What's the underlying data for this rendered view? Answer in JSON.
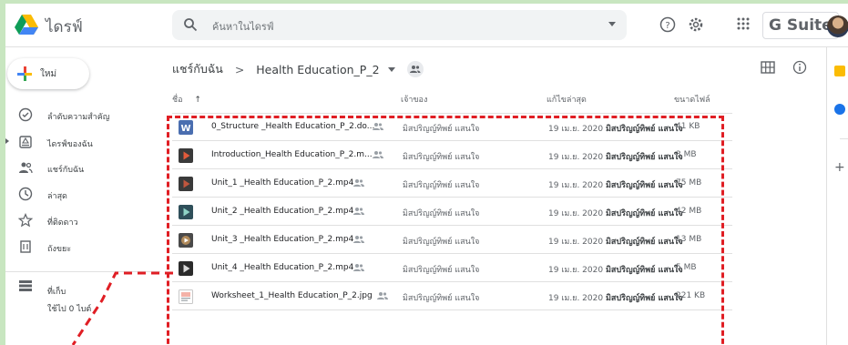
{
  "header": {
    "app_title": "ไดรฟ์",
    "search_placeholder": "ค้นหาในไดรฟ์",
    "brand": "G Suite"
  },
  "sidebar": {
    "new_label": "ใหม่",
    "items": [
      {
        "label": "ลำดับความสำคัญ",
        "icon": "check-circle-icon"
      },
      {
        "label": "ไดรฟ์ของฉัน",
        "icon": "my-drive-icon"
      },
      {
        "label": "แชร์กับฉัน",
        "icon": "shared-with-me-icon"
      },
      {
        "label": "ล่าสุด",
        "icon": "clock-icon"
      },
      {
        "label": "ที่ติดดาว",
        "icon": "star-icon"
      },
      {
        "label": "ถังขยะ",
        "icon": "trash-icon"
      }
    ],
    "storage": {
      "label": "ที่เก็บ",
      "used": "ใช้ไป 0 ไบต์"
    }
  },
  "breadcrumb": {
    "root": "แชร์กับฉัน",
    "current": "Health Education_P_2"
  },
  "columns": {
    "name": "ชื่อ",
    "sort_arrow": "↑",
    "owner": "เจ้าของ",
    "modified": "แก้ไขล่าสุด",
    "size": "ขนาดไฟล์"
  },
  "files": [
    {
      "name": "0_Structure _Health Education_P_2.do...",
      "type": "word",
      "owner": "มิสปริญญ์ทิพย์ แสนใจ",
      "date": "19 เม.ย. 2020",
      "modifier": "มิสปริญญ์ทิพย์ แสนใจ",
      "size": "41 KB"
    },
    {
      "name": "Introduction_Health Education_P_2.m...",
      "type": "video",
      "owner": "มิสปริญญ์ทิพย์ แสนใจ",
      "date": "19 เม.ย. 2020",
      "modifier": "มิสปริญญ์ทิพย์ แสนใจ",
      "size": "3 MB"
    },
    {
      "name": "Unit_1 _Health Education_P_2.mp4",
      "type": "video",
      "owner": "มิสปริญญ์ทิพย์ แสนใจ",
      "date": "19 เม.ย. 2020",
      "modifier": "มิสปริญญ์ทิพย์ แสนใจ",
      "size": "75 MB"
    },
    {
      "name": "Unit_2 _Health Education_P_2.mp4",
      "type": "video",
      "owner": "มิสปริญญ์ทิพย์ แสนใจ",
      "date": "19 เม.ย. 2020",
      "modifier": "มิสปริญญ์ทิพย์ แสนใจ",
      "size": "42 MB"
    },
    {
      "name": "Unit_3 _Health Education_P_2.mp4",
      "type": "video",
      "owner": "มิสปริญญ์ทิพย์ แสนใจ",
      "date": "19 เม.ย. 2020",
      "modifier": "มิสปริญญ์ทิพย์ แสนใจ",
      "size": "13 MB"
    },
    {
      "name": "Unit_4 _Health Education_P_2.mp4",
      "type": "video",
      "owner": "มิสปริญญ์ทิพย์ แสนใจ",
      "date": "19 เม.ย. 2020",
      "modifier": "มิสปริญญ์ทิพย์ แสนใจ",
      "size": "5 MB"
    },
    {
      "name": "Worksheet_1_Health Education_P_2.jpg",
      "type": "image",
      "owner": "มิสปริญญ์ทิพย์ แสนใจ",
      "date": "19 เม.ย. 2020",
      "modifier": "มิสปริญญ์ทิพย์ แสนใจ",
      "size": "221 KB"
    }
  ],
  "colors": {
    "accent": "#1a73e8",
    "annotation": "#e01e24",
    "frame": "#c8e6c0"
  }
}
